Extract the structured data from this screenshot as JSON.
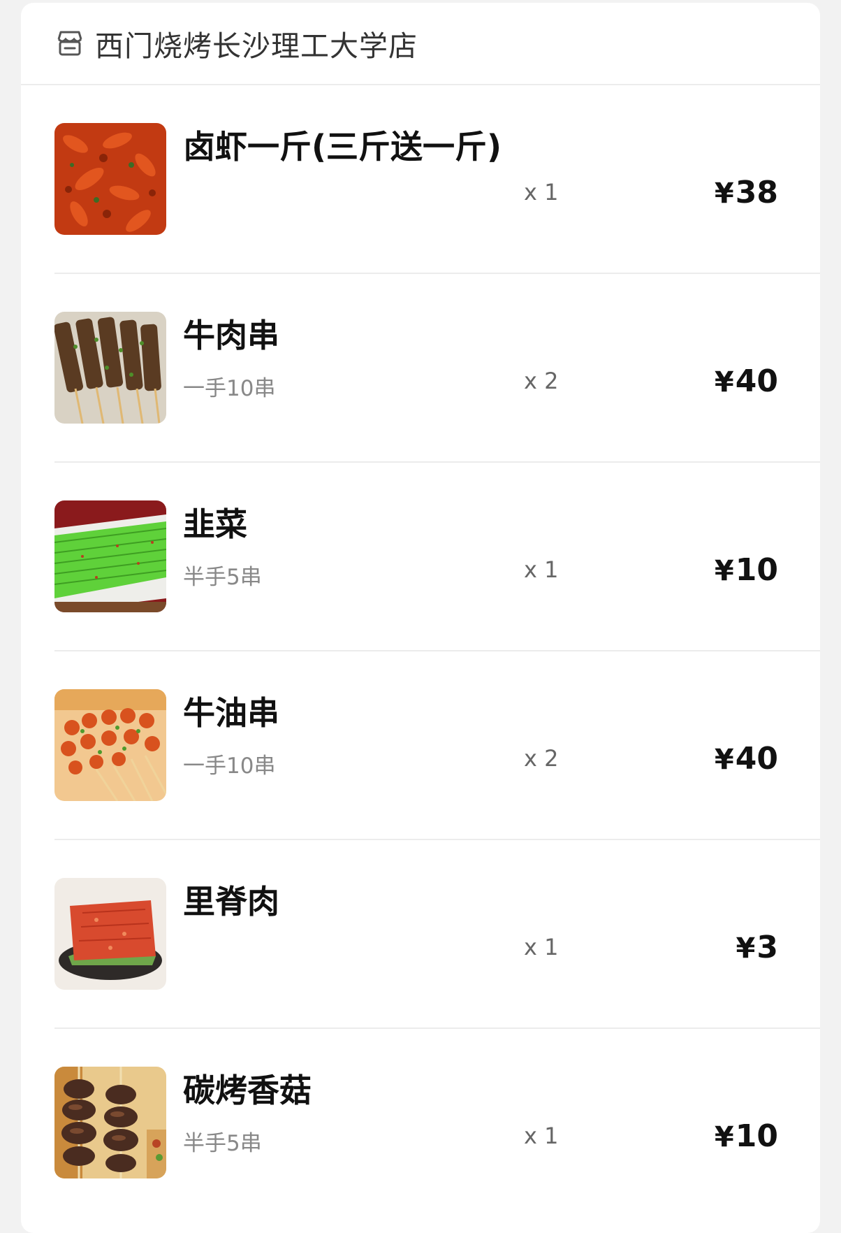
{
  "store": {
    "name": "西门烧烤长沙理工大学店",
    "icon": "store-icon"
  },
  "currency": "¥",
  "items": [
    {
      "name": "卤虾一斤(三斤送一斤)",
      "spec": "",
      "qty": "x 1",
      "price": "38",
      "thumb": "crayfish"
    },
    {
      "name": "牛肉串",
      "spec": "一手10串",
      "qty": "x 2",
      "price": "40",
      "thumb": "beef-skewers"
    },
    {
      "name": "韭菜",
      "spec": "半手5串",
      "qty": "x 1",
      "price": "10",
      "thumb": "chives"
    },
    {
      "name": "牛油串",
      "spec": "一手10串",
      "qty": "x 2",
      "price": "40",
      "thumb": "tallow-skewers"
    },
    {
      "name": "里脊肉",
      "spec": "",
      "qty": "x 1",
      "price": "3",
      "thumb": "tenderloin"
    },
    {
      "name": "碳烤香菇",
      "spec": "半手5串",
      "qty": "x 1",
      "price": "10",
      "thumb": "mushroom"
    }
  ],
  "colors": {
    "text": "#111111",
    "secondary": "#888888",
    "divider": "#ececec",
    "background": "#f2f2f2"
  }
}
